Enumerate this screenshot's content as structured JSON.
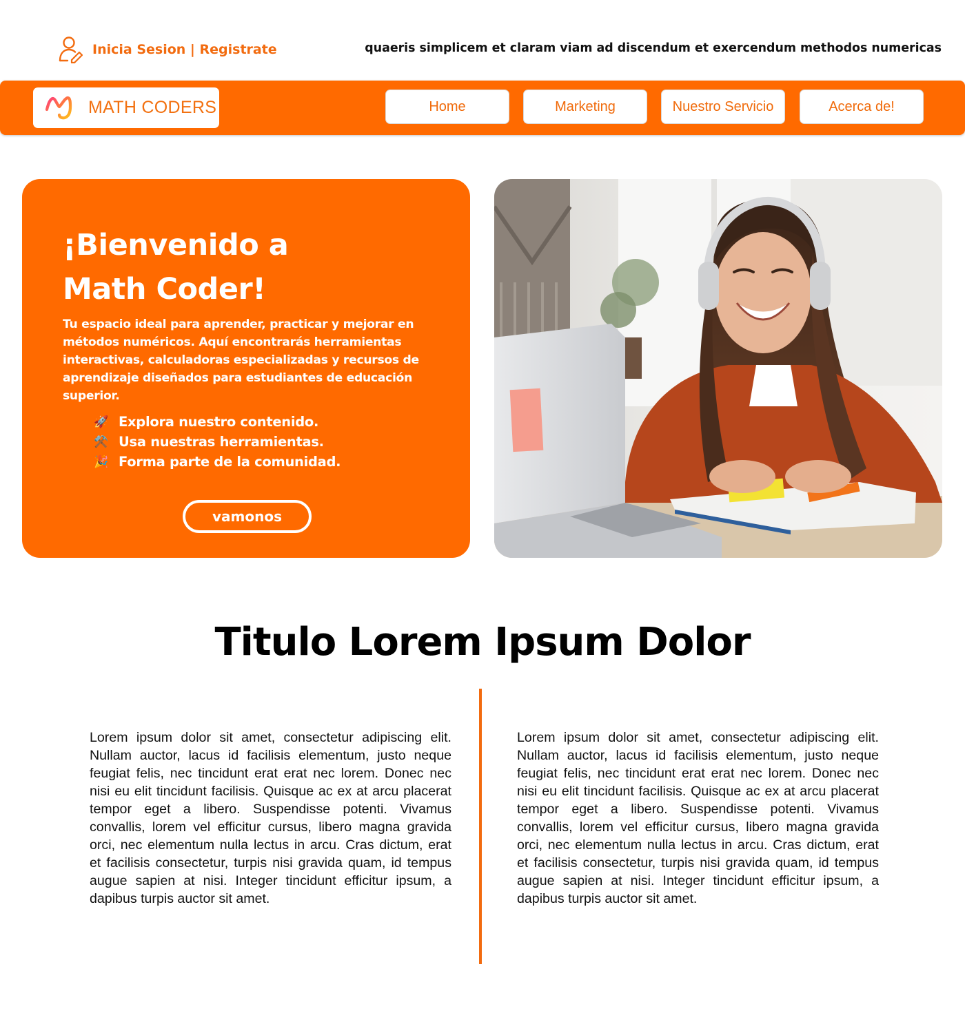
{
  "topbar": {
    "login_label": "Inicia Sesion",
    "separator": "|",
    "register_label": "Registrate",
    "tagline": "quaeris simplicem et claram viam ad discendum et exercendum methodos numericas"
  },
  "brand": {
    "name": "MATH CODERS"
  },
  "nav": {
    "items": [
      {
        "label": "Home"
      },
      {
        "label": "Marketing"
      },
      {
        "label": "Nuestro Servicio"
      },
      {
        "label": "Acerca de!"
      }
    ]
  },
  "hero": {
    "title_line1": "¡Bienvenido a",
    "title_line2": "Math Coder!",
    "description": "Tu espacio ideal para aprender, practicar y mejorar en métodos numéricos. Aquí encontrarás herramientas interactivas, calculadoras especializadas y recursos de aprendizaje diseñados para estudiantes de educación superior.",
    "bullets": [
      {
        "emoji": "🚀",
        "text": "Explora nuestro contenido."
      },
      {
        "emoji": "⚒️",
        "text": "Usa nuestras herramientas."
      },
      {
        "emoji": "🎉",
        "text": "Forma parte de la comunidad."
      }
    ],
    "cta_label": "vamonos"
  },
  "section": {
    "title": "Titulo Lorem Ipsum Dolor",
    "left_text": "Lorem ipsum dolor sit amet, consectetur adipiscing elit. Nullam auctor, lacus id facilisis elementum, justo neque feugiat felis, nec tincidunt erat erat nec lorem. Donec nec nisi eu elit tincidunt facilisis. Quisque ac ex at arcu placerat tempor eget a libero. Suspendisse potenti. Vivamus convallis, lorem vel efficitur cursus, libero magna gravida orci, nec elementum nulla lectus in arcu. Cras dictum, erat et facilisis consectetur, turpis nisi gravida quam, id tempus augue sapien at nisi. Integer tincidunt efficitur ipsum, a dapibus turpis auctor sit amet.",
    "right_text": "Lorem ipsum dolor sit amet, consectetur adipiscing elit. Nullam auctor, lacus id facilisis elementum, justo neque feugiat felis, nec tincidunt erat erat nec lorem. Donec nec nisi eu elit tincidunt facilisis. Quisque ac ex at arcu placerat tempor eget a libero. Suspendisse potenti. Vivamus convallis, lorem vel efficitur cursus, libero magna gravida orci, nec elementum nulla lectus in arcu. Cras dictum, erat et facilisis consectetur, turpis nisi gravida quam, id tempus augue sapien at nisi. Integer tincidunt efficitur ipsum, a dapibus turpis auctor sit amet."
  },
  "icons": {
    "user": "user-edit-icon",
    "logo": "math-coders-logo-icon"
  },
  "colors": {
    "accent": "#FF6A00",
    "accent_text": "#F26B0F",
    "background": "#FFFFFF"
  }
}
